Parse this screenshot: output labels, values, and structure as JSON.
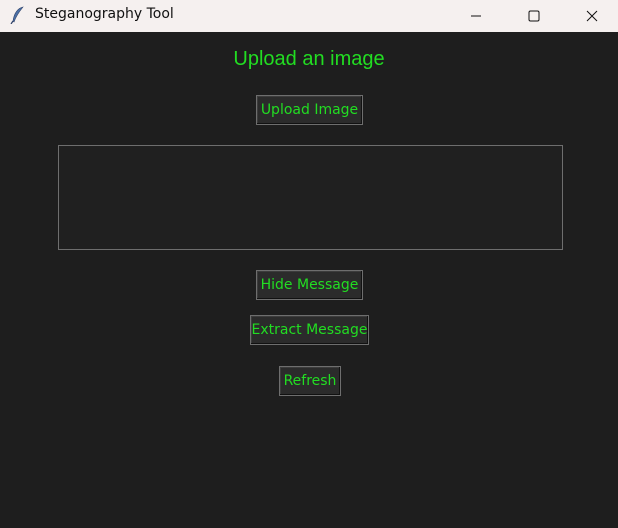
{
  "window": {
    "title": "Steganography Tool",
    "app_icon": "feather-icon",
    "controls": {
      "minimize_icon": "minimize-icon",
      "maximize_icon": "maximize-icon",
      "close_icon": "close-icon"
    }
  },
  "main": {
    "heading": "Upload an image",
    "upload_button_label": "Upload Image",
    "message_box_value": "",
    "hide_button_label": "Hide Message",
    "extract_button_label": "Extract Message",
    "refresh_button_label": "Refresh"
  },
  "colors": {
    "background": "#1e1e1e",
    "titlebar": "#f5f0ef",
    "accent_text": "#22dd22",
    "button_background": "#2b2b2b",
    "border": "#6e6e6e"
  }
}
